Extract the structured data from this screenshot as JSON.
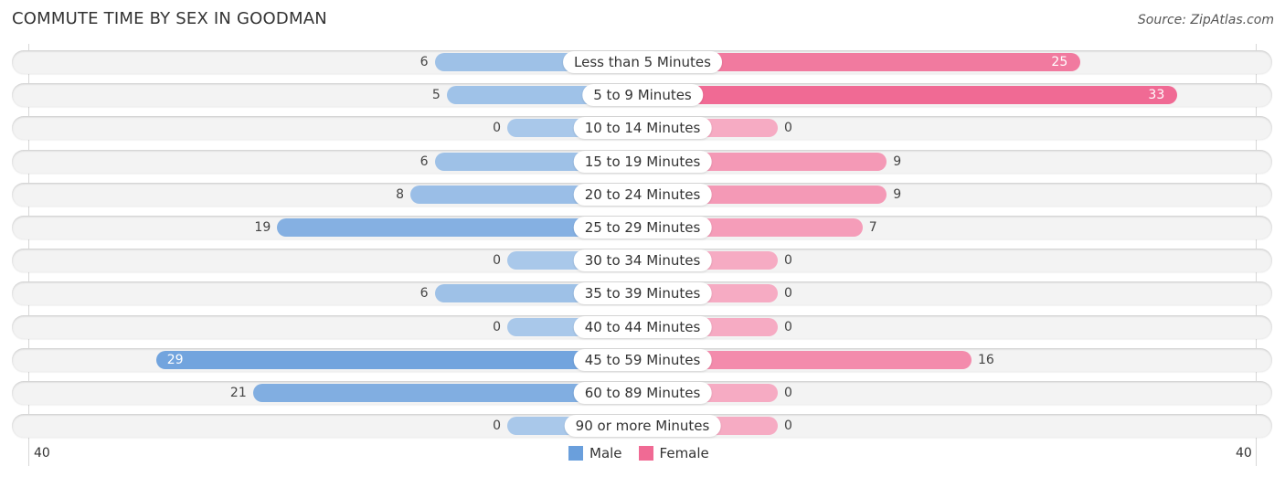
{
  "chart_data": {
    "type": "bar",
    "orientation": "horizontal-diverging",
    "title": "COMMUTE TIME BY SEX IN GOODMAN",
    "source": "Source: ZipAtlas.com",
    "categories": [
      "Less than 5 Minutes",
      "5 to 9 Minutes",
      "10 to 14 Minutes",
      "15 to 19 Minutes",
      "20 to 24 Minutes",
      "25 to 29 Minutes",
      "30 to 34 Minutes",
      "35 to 39 Minutes",
      "40 to 44 Minutes",
      "45 to 59 Minutes",
      "60 to 89 Minutes",
      "90 or more Minutes"
    ],
    "series": [
      {
        "name": "Male",
        "color": "#6a9fdc",
        "values": [
          6,
          5,
          0,
          6,
          8,
          19,
          0,
          6,
          0,
          29,
          21,
          0
        ]
      },
      {
        "name": "Female",
        "color": "#f06a94",
        "values": [
          25,
          33,
          0,
          9,
          9,
          7,
          0,
          0,
          0,
          16,
          0,
          0
        ]
      }
    ],
    "xlim": [
      -40,
      40
    ],
    "tick_labels": {
      "left": "40",
      "right": "40"
    },
    "legend": {
      "position": "bottom-center",
      "entries": [
        "Male",
        "Female"
      ]
    }
  }
}
